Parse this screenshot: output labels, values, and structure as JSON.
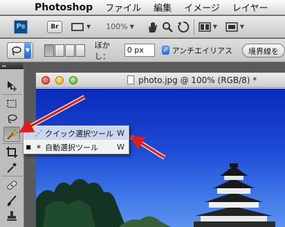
{
  "menubar": {
    "apple_glyph": "",
    "app_name": "Photoshop",
    "items": [
      "ファイル",
      "編集",
      "イメージ",
      "レイヤー"
    ]
  },
  "appbar": {
    "ps_label": "Ps",
    "br_label": "Br",
    "zoom": "100%"
  },
  "options": {
    "feather_label": "ぼかし：",
    "feather_value": "0 px",
    "antialias_label": "アンチエイリアス",
    "antialias_checked": true,
    "refine_edge_label": "境界線を"
  },
  "document": {
    "title": "photo.jpg @ 100% (RGB/8) *"
  },
  "flyout": {
    "items": [
      {
        "label": "クイック選択ツール",
        "shortcut": "W",
        "highlighted": true,
        "selected": false
      },
      {
        "label": "自動選択ツール",
        "shortcut": "W",
        "highlighted": false,
        "selected": true
      }
    ]
  },
  "colors": {
    "arrow": "#e21a1a",
    "sky_top": "#0a29b8",
    "menu_highlight": "#c9d6ee"
  }
}
